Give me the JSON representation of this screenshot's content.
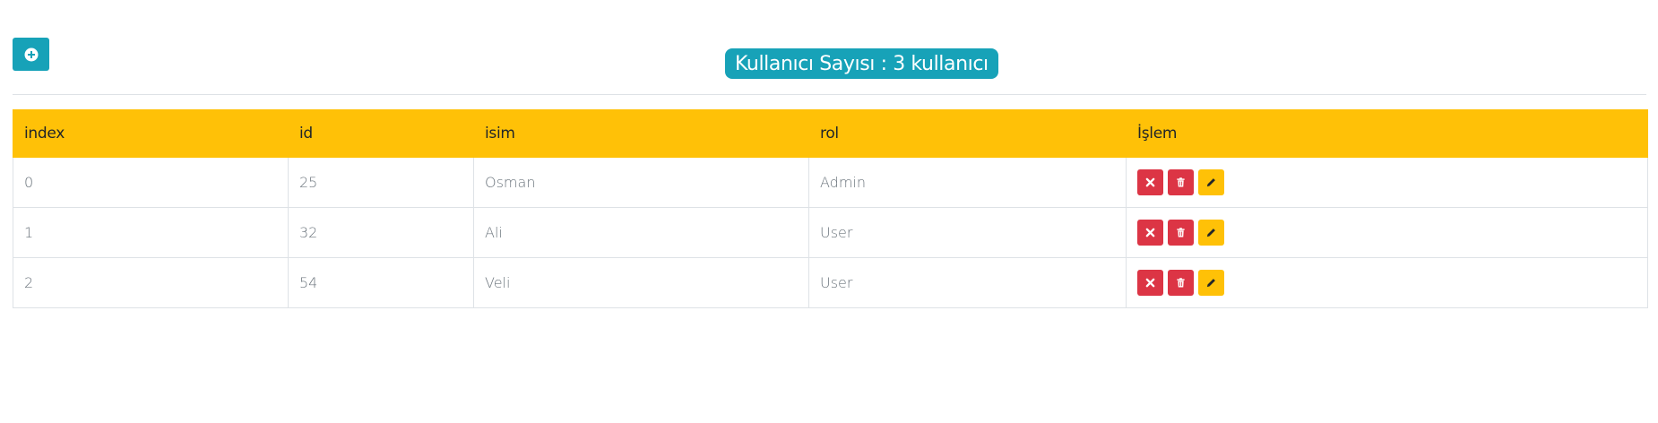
{
  "toolbar": {
    "add_icon": "plus-circle-icon"
  },
  "header": {
    "user_count_text": "Kullanıcı Sayısı : 3 kullanıcı"
  },
  "table": {
    "columns": [
      "index",
      "id",
      "isim",
      "rol",
      "İşlem"
    ],
    "rows": [
      {
        "index": "0",
        "id": "25",
        "name": "Osman",
        "role": "Admin"
      },
      {
        "index": "1",
        "id": "32",
        "name": "Ali",
        "role": "User"
      },
      {
        "index": "2",
        "id": "54",
        "name": "Veli",
        "role": "User"
      }
    ],
    "action_icons": [
      "times-icon",
      "trash-icon",
      "pencil-icon"
    ]
  },
  "colors": {
    "accent": "#17a2b8",
    "header_bg": "#ffc107",
    "danger": "#dc3545",
    "warning": "#ffc107"
  }
}
